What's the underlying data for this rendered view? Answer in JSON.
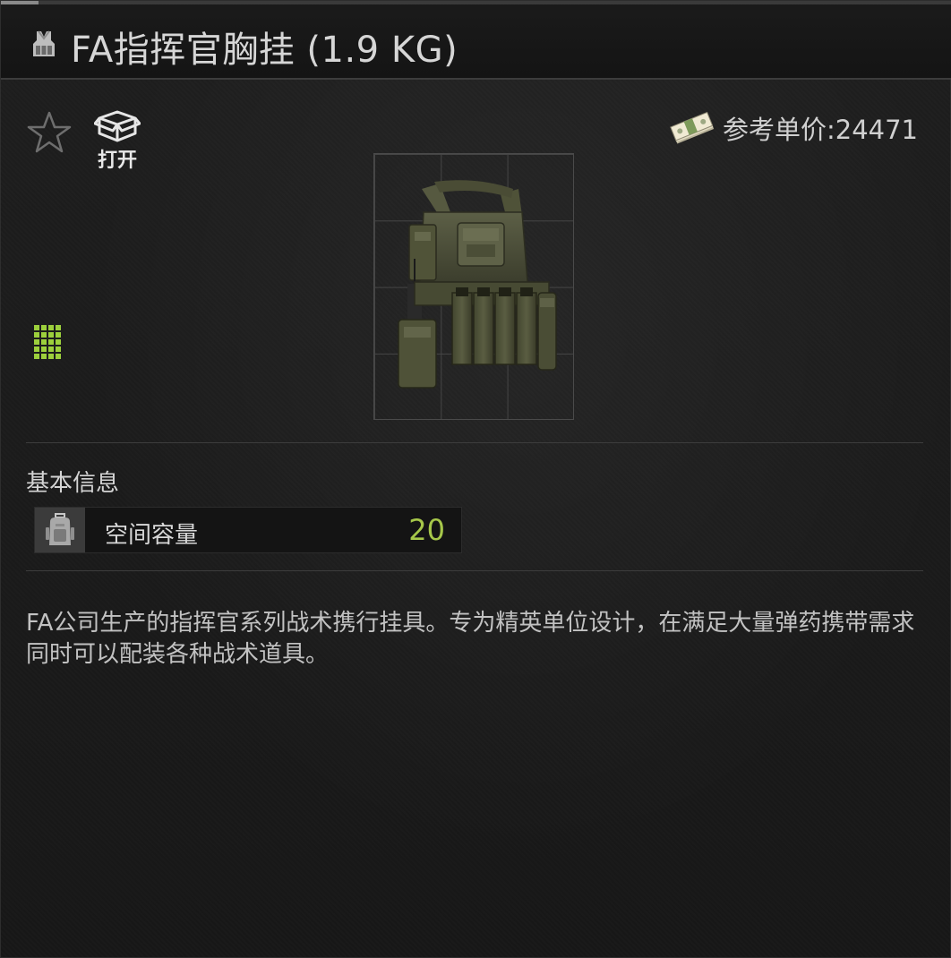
{
  "window": {
    "title": "FA指挥官胸挂 (1.9 KG)",
    "title_icon": "vest-icon"
  },
  "actions": {
    "favorite_icon": "star-icon",
    "open_icon": "open-box-icon",
    "open_label": "打开"
  },
  "price": {
    "icon": "money-bundle-icon",
    "label": "参考单价:24471"
  },
  "item": {
    "image": "tactical-chest-rig",
    "size_indicator_icon": "grid-size-icon"
  },
  "basic_info": {
    "title": "基本信息",
    "stats": [
      {
        "icon": "backpack-icon",
        "label": "空间容量",
        "value": "20"
      }
    ]
  },
  "description": "FA公司生产的指挥官系列战术携行挂具。专为精英单位设计，在满足大量弹药携带需求同时可以配装各种战术道具。",
  "colors": {
    "accent_green": "#a6c74a",
    "size_indicator": "#9ccf3c",
    "background": "#1c1c1c"
  }
}
